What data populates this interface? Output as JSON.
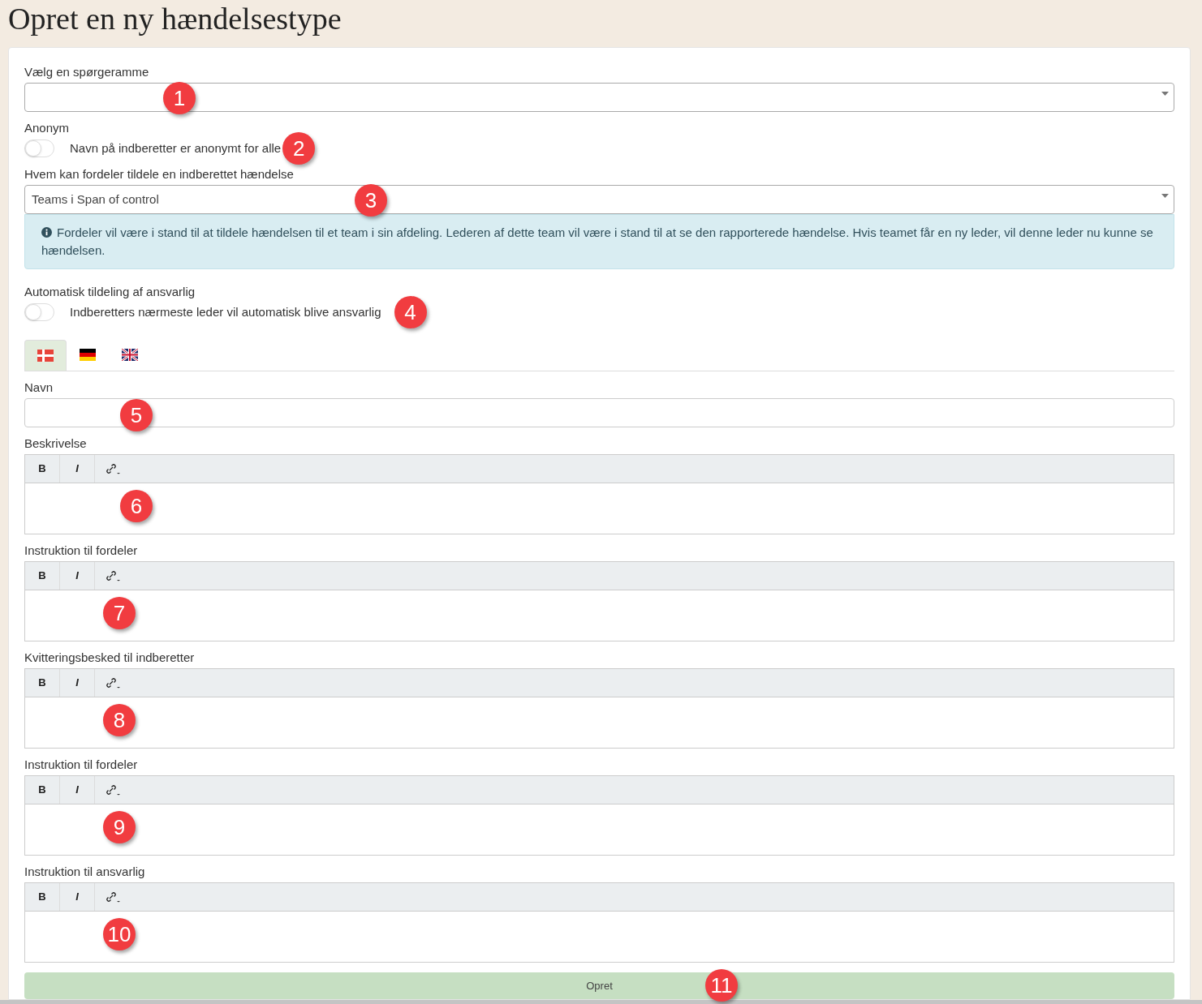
{
  "page_title": "Opret en ny hændelsestype",
  "fields": [
    {
      "kind": "select",
      "label": "Vælg en spørgeramme",
      "marker": "1"
    },
    {
      "kind": "toggle",
      "label": "Anonym",
      "text": "Navn på indberetter er anonymt for alle",
      "on": false,
      "marker": "2"
    },
    {
      "kind": "select",
      "label": "Hvem kan fordeler tildele en indberettet hændelse",
      "value": "Teams i Span of control",
      "marker": "3",
      "info": "Fordeler vil være i stand til at tildele hændelsen til et team i sin afdeling. Lederen af dette team vil være i stand til at se den rapporterede hændelse. Hvis teamet får en ny leder, vil denne leder nu kunne se hændelsen."
    },
    {
      "kind": "toggle",
      "label": "Automatisk tildeling af ansvarlig",
      "text": "Indberetters nærmeste leder vil automatisk blive ansvarlig",
      "on": false,
      "marker": "4"
    },
    {
      "kind": "tabs",
      "tabs": [
        {
          "selected": true
        },
        {
          "selected": false
        },
        {
          "selected": false
        }
      ]
    },
    {
      "kind": "text",
      "label": "Navn",
      "marker": "5"
    },
    {
      "kind": "editor",
      "label": "Beskrivelse",
      "bold": "B",
      "italic": "I",
      "marker": "6"
    },
    {
      "kind": "editor",
      "label": "Instruktion til fordeler",
      "bold": "B",
      "italic": "I",
      "marker": "7"
    },
    {
      "kind": "editor",
      "label": "Kvitteringsbesked til indberetter",
      "bold": "B",
      "italic": "I",
      "marker": "8"
    },
    {
      "kind": "editor",
      "label": "Instruktion til fordeler",
      "bold": "B",
      "italic": "I",
      "marker": "9"
    },
    {
      "kind": "editor",
      "label": "Instruktion til ansvarlig",
      "bold": "B",
      "italic": "I",
      "marker": "10"
    }
  ],
  "submit": {
    "label": "Opret",
    "marker": "11"
  }
}
